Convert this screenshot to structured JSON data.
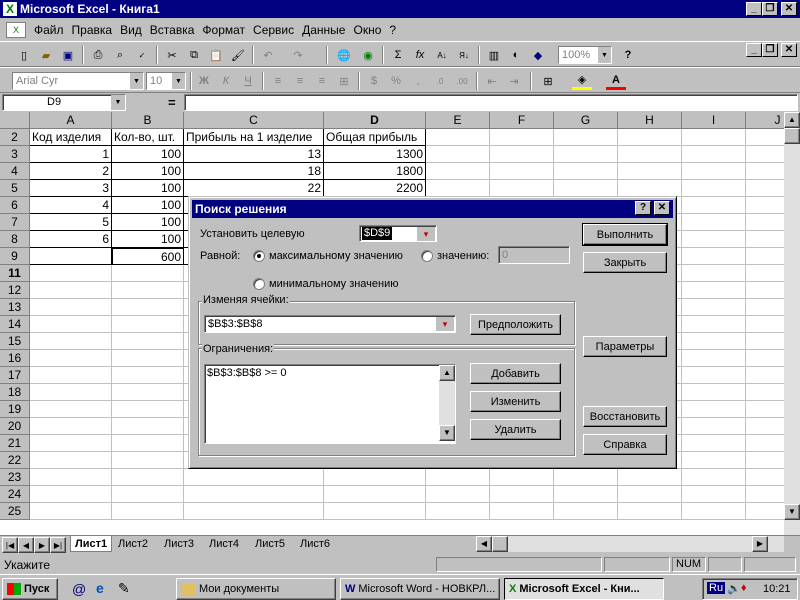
{
  "window": {
    "title": "Microsoft Excel - Книга1"
  },
  "menu": [
    "Файл",
    "Правка",
    "Вид",
    "Вставка",
    "Формат",
    "Сервис",
    "Данные",
    "Окно",
    "?"
  ],
  "toolbar": {
    "zoom": "100%",
    "font": "Arial Cyr",
    "size": "10"
  },
  "formula_bar": {
    "name_box": "D9",
    "equals": "="
  },
  "columns": [
    "A",
    "B",
    "C",
    "D",
    "E",
    "F",
    "G",
    "H",
    "I",
    "J"
  ],
  "rows": [
    {
      "n": "2",
      "cells": [
        "Код изделия",
        "Кол-во, шт.",
        "Прибыль на 1 изделие",
        "Общая прибыль"
      ]
    },
    {
      "n": "3",
      "cells": [
        "1",
        "100",
        "13",
        "1300"
      ]
    },
    {
      "n": "4",
      "cells": [
        "2",
        "100",
        "18",
        "1800"
      ]
    },
    {
      "n": "5",
      "cells": [
        "3",
        "100",
        "22",
        "2200"
      ]
    },
    {
      "n": "6",
      "cells": [
        "4",
        "100",
        "",
        ""
      ]
    },
    {
      "n": "7",
      "cells": [
        "5",
        "100",
        "",
        ""
      ]
    },
    {
      "n": "8",
      "cells": [
        "6",
        "100",
        "",
        ""
      ]
    },
    {
      "n": "9",
      "cells": [
        "",
        "600",
        "",
        ""
      ]
    },
    {
      "n": "11",
      "cells": [
        "",
        "",
        "",
        ""
      ]
    },
    {
      "n": "12",
      "cells": [
        "",
        "",
        "",
        ""
      ]
    },
    {
      "n": "13",
      "cells": [
        "",
        "",
        "",
        ""
      ]
    },
    {
      "n": "14",
      "cells": [
        "",
        "",
        "",
        ""
      ]
    },
    {
      "n": "15",
      "cells": [
        "",
        "",
        "",
        ""
      ]
    },
    {
      "n": "16",
      "cells": [
        "",
        "",
        "",
        ""
      ]
    },
    {
      "n": "17",
      "cells": [
        "",
        "",
        "",
        ""
      ]
    },
    {
      "n": "18",
      "cells": [
        "",
        "",
        "",
        ""
      ]
    },
    {
      "n": "19",
      "cells": [
        "",
        "",
        "",
        ""
      ]
    },
    {
      "n": "20",
      "cells": [
        "",
        "",
        "",
        ""
      ]
    },
    {
      "n": "21",
      "cells": [
        "",
        "",
        "",
        ""
      ]
    },
    {
      "n": "22",
      "cells": [
        "",
        "",
        "",
        ""
      ]
    },
    {
      "n": "23",
      "cells": [
        "",
        "",
        "",
        ""
      ]
    },
    {
      "n": "24",
      "cells": [
        "",
        "",
        "",
        ""
      ]
    },
    {
      "n": "25",
      "cells": [
        "",
        "",
        "",
        ""
      ]
    }
  ],
  "dialog": {
    "title": "Поиск решения",
    "target_label": "Установить целевую",
    "target_value": "$D$9",
    "equal_label": "Равной:",
    "opt_max": "максимальному значению",
    "opt_value": "значению:",
    "value_field": "0",
    "opt_min": "минимальному значению",
    "changing_label": "Изменяя ячейки:",
    "changing_value": "$B$3:$B$8",
    "guess_button": "Предположить",
    "constraints_label": "Ограничения:",
    "constraints": [
      "$B$3:$B$8 >= 0"
    ],
    "add_button": "Добавить",
    "change_button": "Изменить",
    "delete_button": "Удалить",
    "solve_button": "Выполнить",
    "close_button": "Закрыть",
    "options_button": "Параметры",
    "reset_button": "Восстановить",
    "help_button": "Справка"
  },
  "sheets": [
    "Лист1",
    "Лист2",
    "Лист3",
    "Лист4",
    "Лист5",
    "Лист6"
  ],
  "status": {
    "text": "Укажите",
    "num": "NUM"
  },
  "taskbar": {
    "start": "Пуск",
    "tasks": [
      "Мои документы",
      "Microsoft Word - НОВКРЛ...",
      "Microsoft Excel - Кни..."
    ],
    "lang": "Ru",
    "clock": "10:21"
  }
}
